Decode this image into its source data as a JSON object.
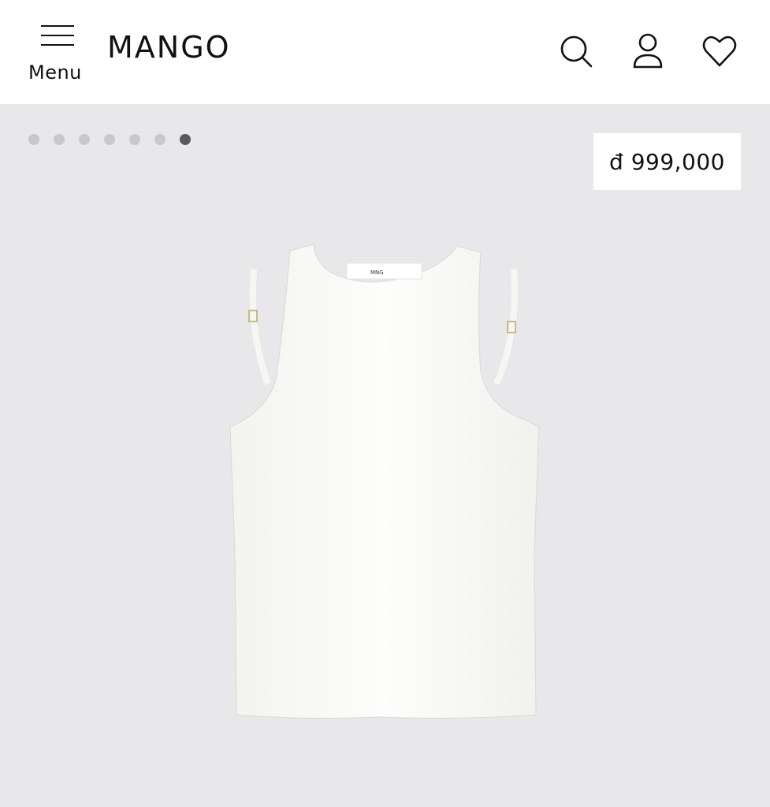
{
  "header": {
    "menu_label": "Menu",
    "logo_text": "MANGO",
    "icons": [
      "search-icon",
      "account-icon",
      "wishlist-heart-icon"
    ]
  },
  "gallery": {
    "image_count": 7,
    "active_index": 6,
    "price": "đ 999,000",
    "tag_brand": "MNG"
  },
  "colors": {
    "header_bg": "#ffffff",
    "gallery_bg": "#e8e8ea",
    "dot_inactive": "#c8c8ca",
    "dot_active": "#5a5a5c",
    "product": "#fbfbf9"
  }
}
